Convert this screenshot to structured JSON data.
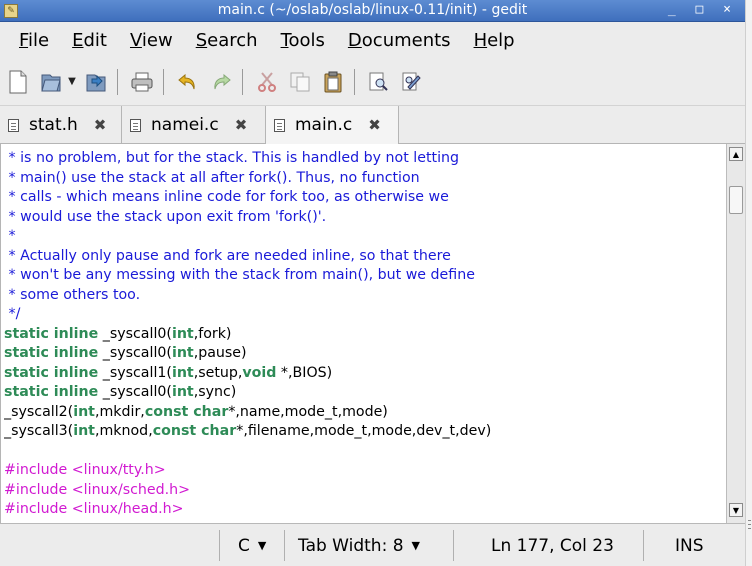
{
  "window": {
    "title": "main.c (~/oslab/oslab/linux-0.11/init) - gedit",
    "controls": "_ □ ×"
  },
  "menu": [
    {
      "label": "File",
      "underline": "F",
      "rest": "ile"
    },
    {
      "label": "Edit",
      "underline": "E",
      "rest": "dit"
    },
    {
      "label": "View",
      "underline": "V",
      "rest": "iew"
    },
    {
      "label": "Search",
      "underline": "S",
      "rest": "earch"
    },
    {
      "label": "Tools",
      "underline": "T",
      "rest": "ools"
    },
    {
      "label": "Documents",
      "underline": "D",
      "rest": "ocuments"
    },
    {
      "label": "Help",
      "underline": "H",
      "rest": "elp"
    }
  ],
  "toolbar_icons": [
    "new-document-icon",
    "open-icon",
    "open-dropdown-icon",
    "save-icon",
    "print-icon",
    "undo-icon",
    "redo-icon",
    "cut-icon",
    "copy-icon",
    "paste-icon",
    "find-icon",
    "find-replace-icon"
  ],
  "tabs": [
    {
      "label": "stat.h",
      "close": "✖"
    },
    {
      "label": "namei.c",
      "close": "✖"
    },
    {
      "label": "main.c",
      "close": "✖"
    }
  ],
  "code_lines": [
    [
      {
        "t": " * is no problem, but for the stack. This is handled by not letting",
        "c": "cmt"
      }
    ],
    [
      {
        "t": " * main() use the stack at all after fork(). Thus, no function",
        "c": "cmt"
      }
    ],
    [
      {
        "t": " * calls - which means inline code for fork too, as otherwise we",
        "c": "cmt"
      }
    ],
    [
      {
        "t": " * would use the stack upon exit from 'fork()'.",
        "c": "cmt"
      }
    ],
    [
      {
        "t": " *",
        "c": "cmt"
      }
    ],
    [
      {
        "t": " * Actually only pause and fork are needed inline, so that there",
        "c": "cmt"
      }
    ],
    [
      {
        "t": " * won't be any messing with the stack from main(), but we define",
        "c": "cmt"
      }
    ],
    [
      {
        "t": " * some others too.",
        "c": "cmt"
      }
    ],
    [
      {
        "t": " */",
        "c": "cmt"
      }
    ],
    [
      {
        "t": "static inline",
        "c": "kw"
      },
      {
        "t": " _syscall0(",
        "c": ""
      },
      {
        "t": "int",
        "c": "kw"
      },
      {
        "t": ",fork)",
        "c": ""
      }
    ],
    [
      {
        "t": "static inline",
        "c": "kw"
      },
      {
        "t": " _syscall0(",
        "c": ""
      },
      {
        "t": "int",
        "c": "kw"
      },
      {
        "t": ",pause)",
        "c": ""
      }
    ],
    [
      {
        "t": "static inline",
        "c": "kw"
      },
      {
        "t": " _syscall1(",
        "c": ""
      },
      {
        "t": "int",
        "c": "kw"
      },
      {
        "t": ",setup,",
        "c": ""
      },
      {
        "t": "void",
        "c": "kw"
      },
      {
        "t": " *,BIOS)",
        "c": ""
      }
    ],
    [
      {
        "t": "static inline",
        "c": "kw"
      },
      {
        "t": " _syscall0(",
        "c": ""
      },
      {
        "t": "int",
        "c": "kw"
      },
      {
        "t": ",sync)",
        "c": ""
      }
    ],
    [
      {
        "t": "_syscall2(",
        "c": ""
      },
      {
        "t": "int",
        "c": "kw"
      },
      {
        "t": ",mkdir,",
        "c": ""
      },
      {
        "t": "const char",
        "c": "kw"
      },
      {
        "t": "*,name,mode_t,mode)",
        "c": ""
      }
    ],
    [
      {
        "t": "_syscall3(",
        "c": ""
      },
      {
        "t": "int",
        "c": "kw"
      },
      {
        "t": ",mknod,",
        "c": ""
      },
      {
        "t": "const char",
        "c": "kw"
      },
      {
        "t": "*,filename,mode_t,mode,dev_t,dev)",
        "c": ""
      }
    ],
    [
      {
        "t": "",
        "c": ""
      }
    ],
    [
      {
        "t": "#include <linux/tty.h>",
        "c": "pp"
      }
    ],
    [
      {
        "t": "#include <linux/sched.h>",
        "c": "pp"
      }
    ],
    [
      {
        "t": "#include <linux/head.h>",
        "c": "pp"
      }
    ]
  ],
  "status": {
    "language": "C",
    "tab_width": "Tab Width:  8",
    "position": "Ln 177, Col 23",
    "mode": "INS"
  },
  "colors": {
    "comment": "#1a1ad8",
    "keyword": "#2e8b57",
    "preprocessor": "#d11ad1",
    "titlebar": "#4a7cc8"
  }
}
